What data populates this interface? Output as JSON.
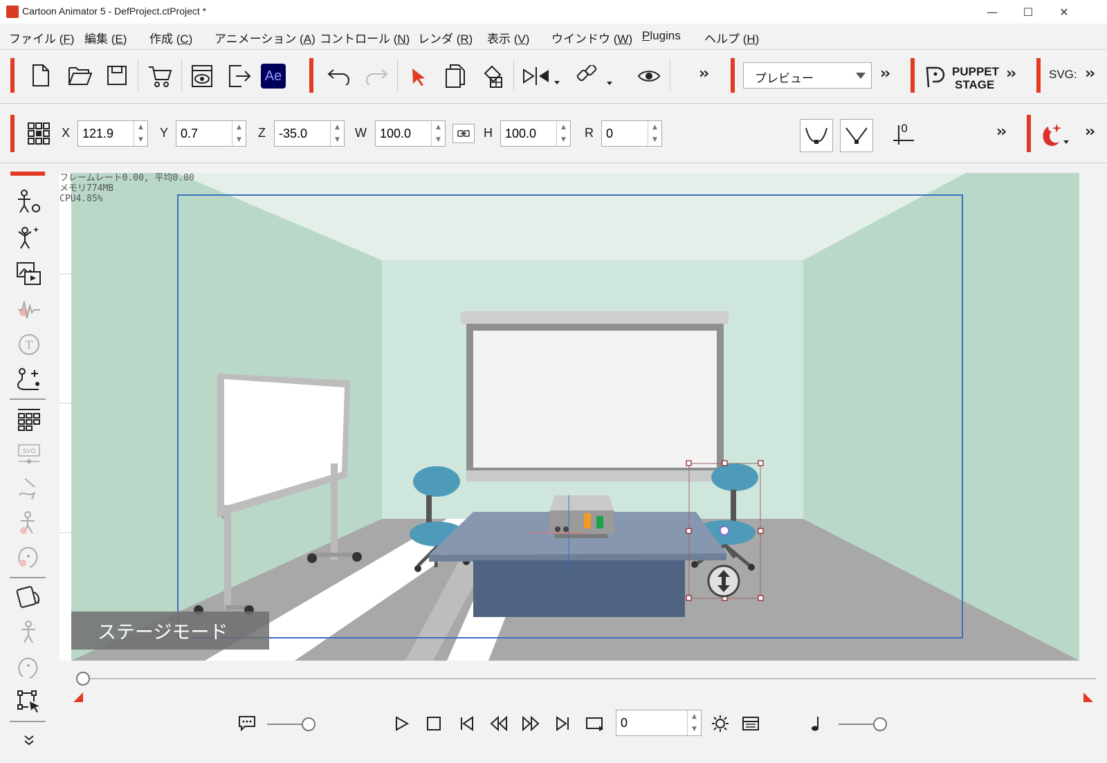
{
  "window": {
    "title": "Cartoon Animator 5 - DefProject.ctProject *",
    "minimize": "—",
    "maximize": "☐",
    "close": "✕"
  },
  "menu": [
    {
      "label": "ファイル (",
      "key": "F",
      "tail": ")"
    },
    {
      "label": "編集 (",
      "key": "E",
      "tail": ")"
    },
    {
      "label": "作成 (",
      "key": "C",
      "tail": ")"
    },
    {
      "label": "アニメーション (",
      "key": "A",
      "tail": ")"
    },
    {
      "label": "コントロール (",
      "key": "N",
      "tail": ")"
    },
    {
      "label": "レンダ (",
      "key": "R",
      "tail": ")"
    },
    {
      "label": "表示 (",
      "key": "V",
      "tail": ")"
    },
    {
      "label": "ウインドウ (",
      "key": "W",
      "tail": ")"
    },
    {
      "label": "",
      "key": "P",
      "tail": "lugins"
    },
    {
      "label": "ヘルプ (",
      "key": "H",
      "tail": ")"
    }
  ],
  "toolbar": {
    "ae_label": "Ae",
    "more": "››",
    "preview_select": "プレビュー",
    "puppet_line1": "PUPPET",
    "puppet_line2": "STAGE",
    "svg_label": "SVG:"
  },
  "transform": {
    "x_label": "X",
    "x_value": "121.9",
    "y_label": "Y",
    "y_value": "0.7",
    "z_label": "Z",
    "z_value": "-35.0",
    "w_label": "W",
    "w_value": "100.0",
    "h_label": "H",
    "h_value": "100.0",
    "r_label": "R",
    "r_value": "0",
    "baseline_value": "0"
  },
  "viewport": {
    "stats_line1": "フレームレート0.00, 平均0.00",
    "stats_line2": "メモリ774MB",
    "stats_line3": "CPU4.85%",
    "mode_label": "ステージモード"
  },
  "playback": {
    "frame_value": "0",
    "timeline_position": 0,
    "bubble_slider": 1.0,
    "volume_slider": 1.0
  },
  "colors": {
    "accent": "#e33b23",
    "wall": "#cfe6dc",
    "side_wall": "#b9d8c8",
    "floor": "#a8a8a8",
    "chair": "#4d9bb8",
    "table_top": "#8797b0",
    "table_front": "#4f6483",
    "selection": "#3a6fc0"
  }
}
